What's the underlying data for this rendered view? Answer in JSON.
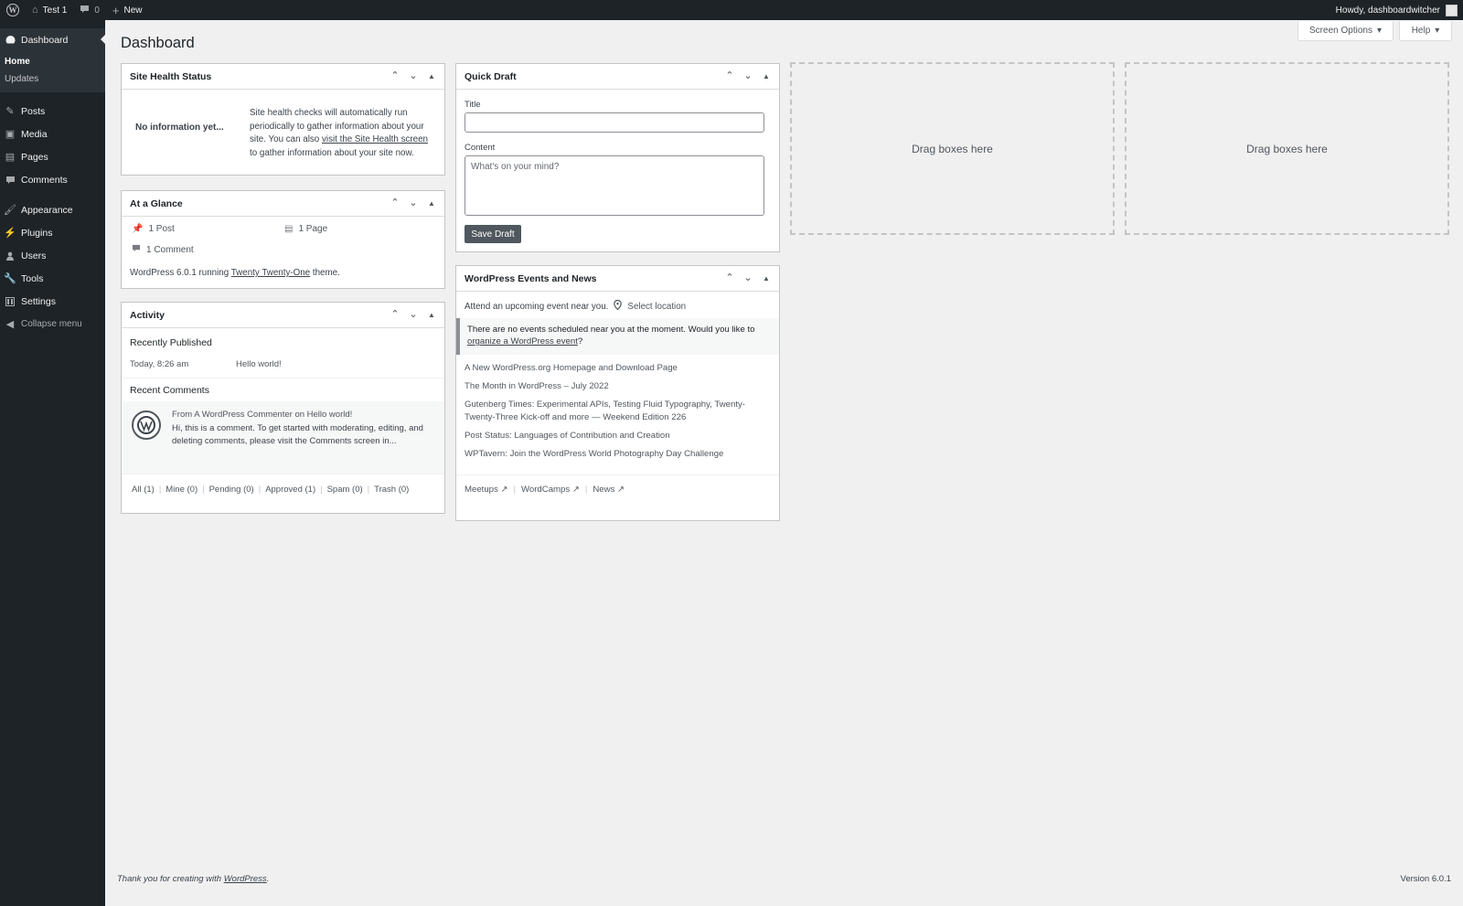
{
  "adminbar": {
    "site_name": "Test 1",
    "comments_count": "0",
    "new_label": "New",
    "howdy": "Howdy, dashboardwitcher"
  },
  "sidebar": {
    "dashboard": "Dashboard",
    "sub_home": "Home",
    "sub_updates": "Updates",
    "items": [
      {
        "label": "Posts",
        "icon": "pin-icon"
      },
      {
        "label": "Media",
        "icon": "media-icon"
      },
      {
        "label": "Pages",
        "icon": "pages-icon"
      },
      {
        "label": "Comments",
        "icon": "comment-icon"
      },
      {
        "label": "Appearance",
        "icon": "brush-icon"
      },
      {
        "label": "Plugins",
        "icon": "plugin-icon"
      },
      {
        "label": "Users",
        "icon": "user-icon"
      },
      {
        "label": "Tools",
        "icon": "wrench-icon"
      },
      {
        "label": "Settings",
        "icon": "settings-icon"
      }
    ],
    "collapse": "Collapse menu"
  },
  "main": {
    "title": "Dashboard",
    "screen_options": "Screen Options",
    "help": "Help"
  },
  "site_health": {
    "title": "Site Health Status",
    "no_info": "No information yet...",
    "text1": "Site health checks will automatically run periodically to gather information about your site. You can also",
    "link": "visit the Site Health screen",
    "text2": "to gather information about your site now."
  },
  "glance": {
    "title": "At a Glance",
    "posts": "1 Post",
    "pages": "1 Page",
    "comments": "1 Comment",
    "running_pre": "WordPress 6.0.1 running",
    "theme": "Twenty Twenty-One",
    "running_post": "theme."
  },
  "activity": {
    "title": "Activity",
    "recently_published": "Recently Published",
    "pub_date": "Today, 8:26 am",
    "pub_title": "Hello world!",
    "recent_comments": "Recent Comments",
    "comment_from": "From A WordPress Commenter on Hello world!",
    "comment_text": "Hi, this is a comment. To get started with moderating, editing, and deleting comments, please visit the Comments screen in...",
    "filters": [
      "All (1)",
      "Mine (0)",
      "Pending (0)",
      "Approved (1)",
      "Spam (0)",
      "Trash (0)"
    ]
  },
  "quick_draft": {
    "title": "Quick Draft",
    "title_label": "Title",
    "content_label": "Content",
    "content_placeholder": "What's on your mind?",
    "save": "Save Draft"
  },
  "events": {
    "title": "WordPress Events and News",
    "attend": "Attend an upcoming event near you.",
    "select_location": "Select location",
    "notice": "There are no events scheduled near you at the moment. Would you like to",
    "notice_link": "organize a WordPress event",
    "notice_end": "?",
    "news": [
      "A New WordPress.org Homepage and Download Page",
      "The Month in WordPress – July 2022",
      "Gutenberg Times: Experimental APIs, Testing Fluid Typography, Twenty-Twenty-Three Kick-off and more — Weekend Edition 226",
      "Post Status: Languages of Contribution and Creation",
      "WPTavern: Join the WordPress World Photography Day Challenge"
    ],
    "footer_links": [
      "Meetups",
      "WordCamps",
      "News"
    ]
  },
  "drop_zones": [
    "Drag boxes here",
    "Drag boxes here"
  ],
  "footer": {
    "thanks_pre": "Thank you for creating with",
    "thanks_link": "WordPress",
    "thanks_post": ".",
    "version": "Version 6.0.1"
  }
}
